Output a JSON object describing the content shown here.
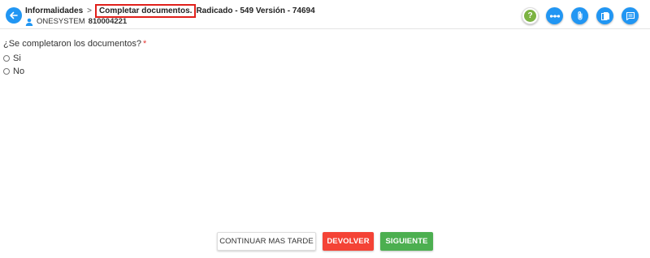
{
  "header": {
    "breadcrumb_parent": "Informalidades",
    "breadcrumb_separator": ">",
    "breadcrumb_current": "Completar documentos.",
    "breadcrumb_rest": "Radicado - 549 Versión - 74694",
    "company_name": "ONESYSTEM",
    "company_id": "810004221"
  },
  "toolbar": {
    "help_glyph": "?",
    "icons": [
      "help-icon",
      "more-horizontal-icon",
      "attachment-icon",
      "documents-icon",
      "comments-icon"
    ]
  },
  "form": {
    "question": "¿Se completaron los documentos?",
    "required_mark": "*",
    "options": [
      {
        "label": "Si",
        "selected": false
      },
      {
        "label": "No",
        "selected": false
      }
    ]
  },
  "actions": {
    "later_label": "CONTINUAR MAS TARDE",
    "return_label": "DEVOLVER",
    "next_label": "SIGUIENTE"
  },
  "colors": {
    "primary": "#2196f3",
    "danger": "#f44336",
    "success": "#4caf50",
    "help": "#7cb342",
    "highlight": "#e0201b"
  }
}
